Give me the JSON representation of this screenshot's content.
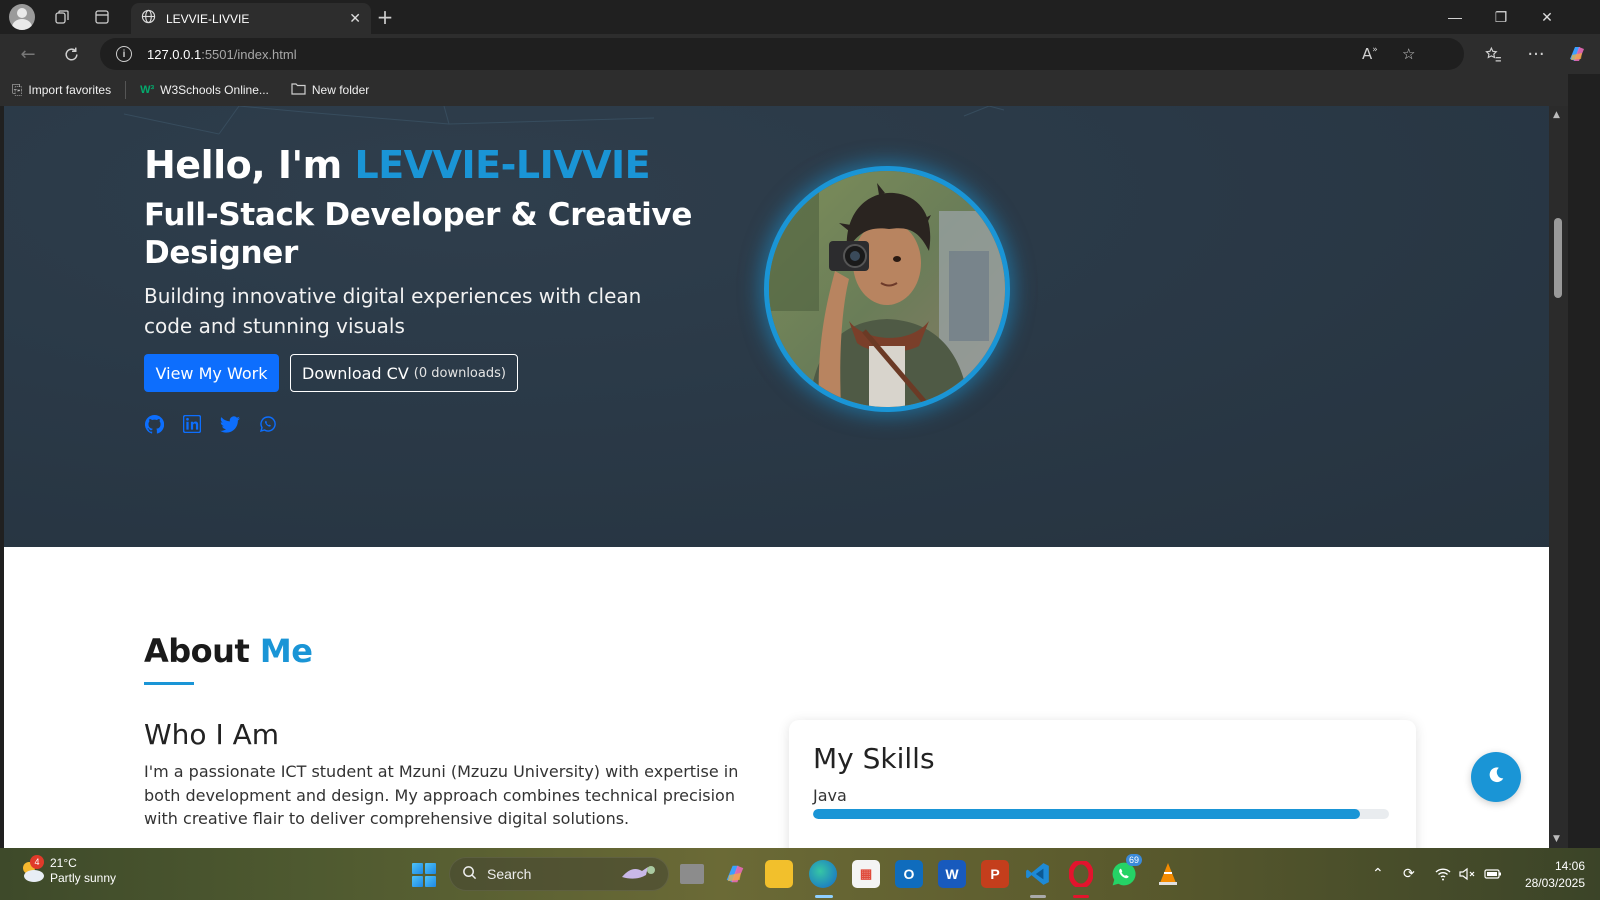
{
  "browser": {
    "tab_title": "LEVVIE-LIVVIE",
    "url_host": "127.0.0.1",
    "url_path": ":5501/index.html",
    "favorites": [
      {
        "label": "Import favorites",
        "icon": "import-icon"
      },
      {
        "label": "W3Schools Online...",
        "icon": "w3schools-icon"
      },
      {
        "label": "New folder",
        "icon": "folder-icon"
      }
    ]
  },
  "hero": {
    "greeting": "Hello, I'm ",
    "name": "LEVVIE-LIVVIE",
    "role": "Full-Stack Developer & Creative Designer",
    "tagline": "Building innovative digital experiences with clean code and stunning visuals",
    "primary_button": "View My Work",
    "cv_button": "Download CV",
    "cv_count": "(0 downloads)",
    "socials": [
      "github-icon",
      "linkedin-icon",
      "twitter-icon",
      "whatsapp-icon"
    ]
  },
  "about": {
    "title_prefix": "About ",
    "title_accent": "Me",
    "who_heading": "Who I Am",
    "who_text": "I'm a passionate ICT student at Mzuni (Mzuzu University) with expertise in both development and design. My approach combines technical precision with creative flair to deliver comprehensive digital solutions.",
    "skills_title": "My Skills",
    "skills": [
      {
        "name": "Java",
        "level": 0.95
      }
    ]
  },
  "taskbar": {
    "weather_temp": "21°C",
    "weather_desc": "Partly sunny",
    "weather_badge": "4",
    "search_placeholder": "Search",
    "whatsapp_badge": "69",
    "time": "14:06",
    "date": "28/03/2025"
  },
  "colors": {
    "accent": "#1a95d6",
    "primary_button": "#0d6efd",
    "hero_bg": "#2a3947"
  }
}
